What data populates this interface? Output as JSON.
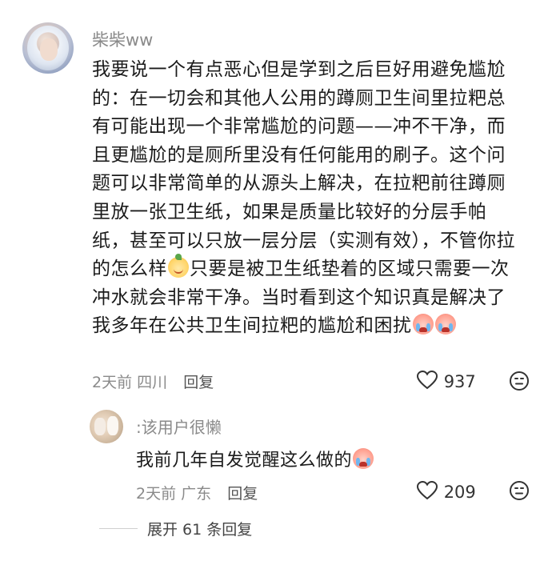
{
  "comment": {
    "username": "柴柴ww",
    "lines": [
      "我要说一个有点恶心但是学到之后巨好用避免尴尬",
      "的：在一切会和其他人公用的蹲厕卫生间里拉粑总",
      "有可能出现一个非常尴尬的问题——冲不干净，而",
      "且更尴尬的是厕所里没有任何能用的刷子。这个问",
      "题可以非常简单的从源头上解决，在拉粑前往蹲厕",
      "里放一张卫生纸，如果是质量比较好的分层手帕",
      "纸，甚至可以只放一层分层（实测有效），不管你拉",
      "的怎么样",
      "只要是被卫生纸垫着的区域只需要一次",
      "冲水就会非常干净。当时看到这个知识真是解决了",
      "我多年在公共卫生间拉粑的尴尬和困扰"
    ],
    "time": "2天前",
    "location": "四川",
    "reply_label": "回复",
    "likes": "937",
    "icons": {
      "like": "heart-outline-icon",
      "emoji": "smiley-icon"
    }
  },
  "reply": {
    "username": ":该用户很懒",
    "text": "我前几年自发觉醒这么做的",
    "time": "2天前",
    "location": "广东",
    "reply_label": "回复",
    "likes": "209"
  },
  "expand": {
    "label": "展开 61 条回复"
  },
  "colors": {
    "muted": "#8a8a8a",
    "text": "#1b1b1b",
    "background": "#ffffff"
  }
}
